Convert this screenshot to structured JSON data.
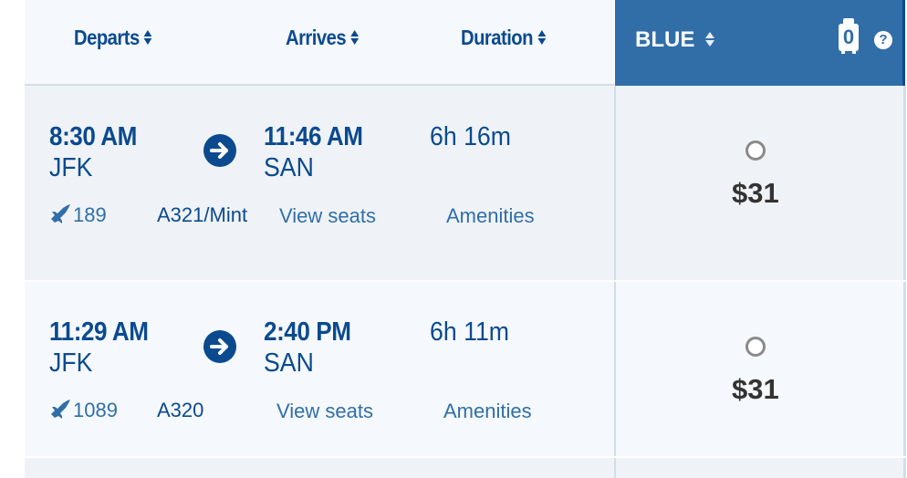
{
  "header": {
    "columns": [
      {
        "label": "Departs"
      },
      {
        "label": "Arrives"
      },
      {
        "label": "Duration"
      }
    ],
    "fare_column": {
      "label": "BLUE",
      "bag_count": "0",
      "help_glyph": "?"
    },
    "icons": {
      "sort": "sort-icon",
      "bag": "carry-on-bag-icon",
      "help": "help-icon"
    }
  },
  "colors": {
    "primary": "#0b4a8f",
    "accent": "#316ea8",
    "row_odd": "#eff3f7",
    "row_even": "#f5f9fd",
    "price": "#333333"
  },
  "flights": [
    {
      "depart_time": "8:30 AM",
      "depart_airport": "JFK",
      "arrive_time": "11:46 AM",
      "arrive_airport": "SAN",
      "duration": "6h 16m",
      "flight_number": "189",
      "aircraft": "A321/Mint",
      "view_seats": "View seats",
      "amenities": "Amenities",
      "fare_price": "$31",
      "fare_selected": false
    },
    {
      "depart_time": "11:29 AM",
      "depart_airport": "JFK",
      "arrive_time": "2:40 PM",
      "arrive_airport": "SAN",
      "duration": "6h 11m",
      "flight_number": "1089",
      "aircraft": "A320",
      "view_seats": "View seats",
      "amenities": "Amenities",
      "fare_price": "$31",
      "fare_selected": false
    }
  ]
}
